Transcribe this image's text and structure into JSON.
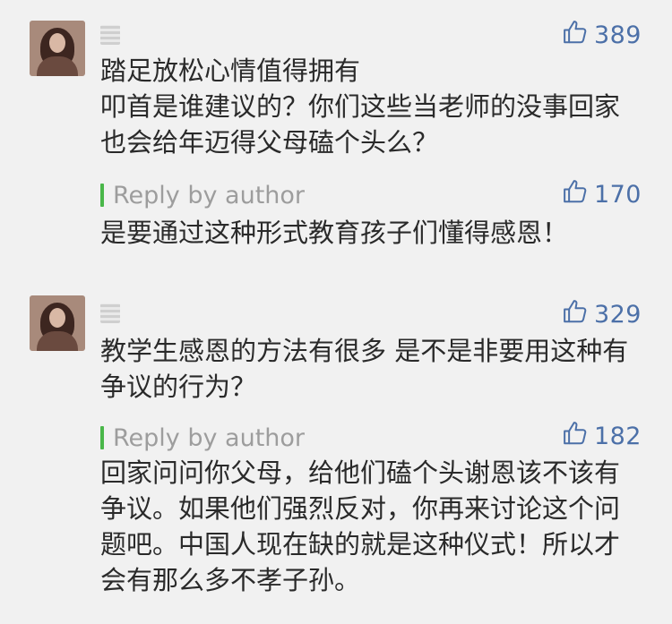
{
  "comments": [
    {
      "likes": "389",
      "text": "踏足放松心情值得拥有\n叩首是谁建议的？你们这些当老师的没事回家也会给年迈得父母磕个头么？",
      "reply": {
        "label": "Reply by author",
        "likes": "170",
        "text": "是要通过这种形式教育孩子们懂得感恩！"
      }
    },
    {
      "likes": "329",
      "text": "教学生感恩的方法有很多 是不是非要用这种有争议的行为？",
      "reply": {
        "label": "Reply by author",
        "likes": "182",
        "text": "回家问问你父母，给他们磕个头谢恩该不该有争议。如果他们强烈反对，你再来讨论这个问题吧。中国人现在缺的就是这种仪式！所以才会有那么多不孝子孙。"
      }
    }
  ],
  "colors": {
    "like": "#4c70a8",
    "reply_bar": "#49b749",
    "reply_label": "#9d9d9d",
    "text": "#2a2a2a"
  }
}
